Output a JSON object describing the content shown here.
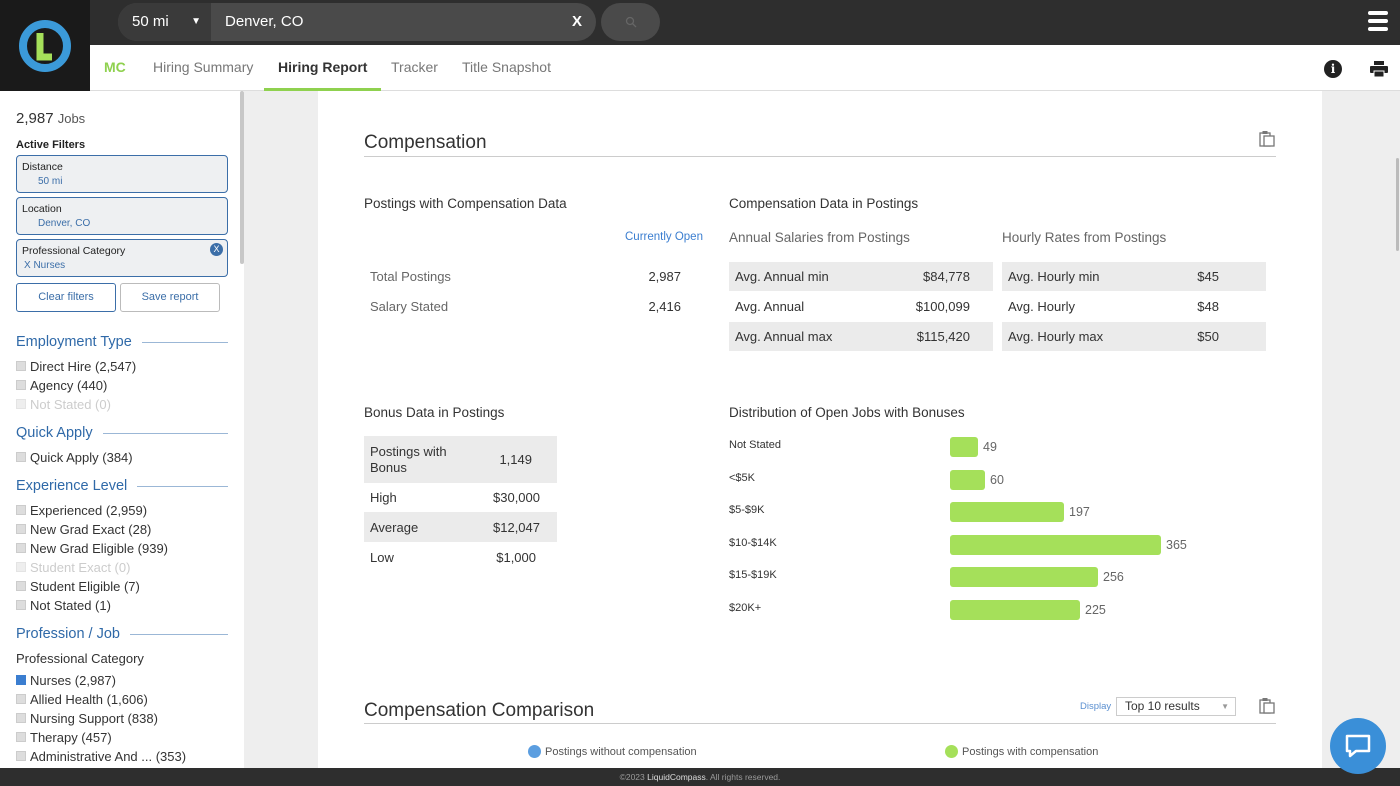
{
  "topbar": {
    "distance": "50 mi",
    "location": "Denver, CO",
    "clear_label": "X"
  },
  "tabs": {
    "mc": "MC",
    "items": [
      "Hiring Summary",
      "Hiring Report",
      "Tracker",
      "Title Snapshot"
    ],
    "active": "Hiring Report"
  },
  "sidebar": {
    "jobs_count": "2,987",
    "jobs_label": "Jobs",
    "active_filters_title": "Active Filters",
    "filters": [
      {
        "label": "Distance",
        "value": "50 mi"
      },
      {
        "label": "Location",
        "value": "Denver, CO"
      },
      {
        "label": "Professional Category",
        "value": "Nurses",
        "prefix": "X",
        "close": "X"
      }
    ],
    "clear_button": "Clear filters",
    "save_button": "Save report",
    "employment_type": {
      "title": "Employment Type",
      "options": [
        "Direct Hire (2,547)",
        "Agency (440)",
        "Not Stated (0)"
      ]
    },
    "quick_apply": {
      "title": "Quick Apply",
      "options": [
        "Quick Apply (384)"
      ]
    },
    "experience_level": {
      "title": "Experience Level",
      "options": [
        "Experienced (2,959)",
        "New Grad Exact (28)",
        "New Grad Eligible (939)",
        "Student Exact (0)",
        "Student Eligible (7)",
        "Not Stated (1)"
      ]
    },
    "profession": {
      "title": "Profession / Job",
      "subtitle": "Professional Category",
      "options": [
        "Nurses (2,987)",
        "Allied Health (1,606)",
        "Nursing Support (838)",
        "Therapy (457)",
        "Administrative And ... (353)"
      ]
    }
  },
  "compensation": {
    "title": "Compensation",
    "postings_title": "Postings with Compensation Data",
    "currently_open": "Currently Open",
    "postings_rows": [
      {
        "label": "Total Postings",
        "value": "2,987"
      },
      {
        "label": "Salary Stated",
        "value": "2,416"
      }
    ],
    "comp_data_title": "Compensation Data in Postings",
    "annual_title": "Annual Salaries from Postings",
    "annual_rows": [
      {
        "label": "Avg. Annual min",
        "value": "$84,778"
      },
      {
        "label": "Avg. Annual",
        "value": "$100,099"
      },
      {
        "label": "Avg. Annual max",
        "value": "$115,420"
      }
    ],
    "hourly_title": "Hourly Rates from Postings",
    "hourly_rows": [
      {
        "label": "Avg. Hourly min",
        "value": "$45"
      },
      {
        "label": "Avg. Hourly",
        "value": "$48"
      },
      {
        "label": "Avg. Hourly max",
        "value": "$50"
      }
    ],
    "bonus_title": "Bonus Data in Postings",
    "bonus_rows": [
      {
        "label": "Postings with Bonus",
        "value": "1,149"
      },
      {
        "label": "High",
        "value": "$30,000"
      },
      {
        "label": "Average",
        "value": "$12,047"
      },
      {
        "label": "Low",
        "value": "$1,000"
      }
    ],
    "distribution_title": "Distribution of Open Jobs with Bonuses"
  },
  "chart_data": {
    "type": "bar",
    "orientation": "horizontal",
    "title": "Distribution of Open Jobs with Bonuses",
    "categories": [
      "Not Stated",
      "<$5K",
      "$5-$9K",
      "$10-$14K",
      "$15-$19K",
      "$20K+"
    ],
    "values": [
      49,
      60,
      197,
      365,
      256,
      225
    ],
    "color": "#a5e05a"
  },
  "comparison": {
    "title": "Compensation Comparison",
    "display_label": "Display",
    "display_value": "Top 10 results",
    "legend": [
      {
        "label": "Postings without compensation",
        "color": "#5b9ee0"
      },
      {
        "label": "Postings with compensation",
        "color": "#a5e05a"
      }
    ]
  },
  "footer": {
    "copyright_prefix": "©2023",
    "brand": "LiquidCompass",
    "suffix": ". All rights reserved."
  }
}
